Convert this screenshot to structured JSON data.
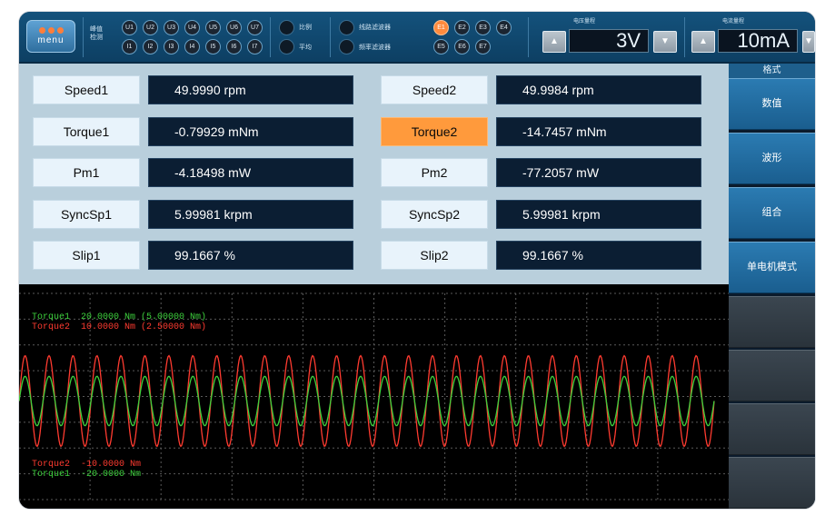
{
  "topbar": {
    "menu_label": "menu",
    "detect_label_1": "峰值",
    "detect_label_2": "检测",
    "u_channels": [
      "U1",
      "U2",
      "U3",
      "U4",
      "U5",
      "U6",
      "U7"
    ],
    "i_channels": [
      "I1",
      "I2",
      "I3",
      "I4",
      "I5",
      "I6",
      "I7"
    ],
    "ratio_label": "比例",
    "average_label": "平均",
    "line_filter_label": "线路滤波器",
    "freq_filter_label": "频率滤波器",
    "e_channels_row1": [
      "E1",
      "E2",
      "E3",
      "E4"
    ],
    "e_channels_row2": [
      "E5",
      "E6",
      "E7"
    ],
    "e_active": "E1",
    "voltage_range_title": "电压量程",
    "voltage_range_value": "3V",
    "current_range_title": "电流量程",
    "current_range_value": "10mA",
    "arrow_down_symbol": "▲",
    "arrow_up_symbol": "▼"
  },
  "measurements": {
    "left": [
      {
        "label": "Speed1",
        "value": "49.9990 rpm"
      },
      {
        "label": "Torque1",
        "value": "-0.79929 mNm"
      },
      {
        "label": "Pm1",
        "value": "-4.18498 mW"
      },
      {
        "label": "SyncSp1",
        "value": "5.99981 krpm"
      },
      {
        "label": "Slip1",
        "value": "99.1667  %"
      }
    ],
    "right": [
      {
        "label": "Speed2",
        "value": "49.9984 rpm"
      },
      {
        "label": "Torque2",
        "value": "-14.7457 mNm"
      },
      {
        "label": "Pm2",
        "value": "-77.2057 mW"
      },
      {
        "label": "SyncSp2",
        "value": "5.99981 krpm"
      },
      {
        "label": "Slip2",
        "value": "99.1667  %"
      }
    ],
    "highlighted": "Torque2"
  },
  "side": {
    "header": "格式",
    "buttons": [
      "数值",
      "波形",
      "组合",
      "单电机模式"
    ]
  },
  "scope": {
    "top_legend": [
      {
        "text": "Torque1  20.0000 Nm (5.00000 Nm)",
        "color": "#3dd13d"
      },
      {
        "text": "Torque2  10.0000 Nm (2.50000 Nm)",
        "color": "#ff3b30"
      }
    ],
    "bottom_legend": [
      {
        "text": "Torque2  -10.0000 Nm",
        "color": "#ff3b30"
      },
      {
        "text": "Torque1  -20.0000 Nm",
        "color": "#3dd13d"
      }
    ],
    "grid_color": "#5a5a5a",
    "series": [
      {
        "name": "Torque1",
        "color": "#3dd13d",
        "cycles": 29,
        "amplitude": 0.12
      },
      {
        "name": "Torque2",
        "color": "#ff3b30",
        "cycles": 29,
        "amplitude": 0.22
      }
    ]
  }
}
